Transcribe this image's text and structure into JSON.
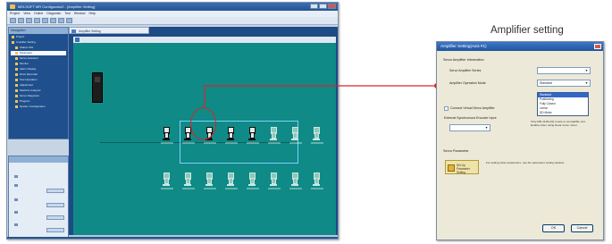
{
  "caption": "Amplifier setting",
  "software_window": {
    "title": "MELSOFT MR Configurator2 - [Amplifier Setting]",
    "menu": [
      "Project",
      "View",
      "Online",
      "Diagnosis",
      "Tool",
      "Window",
      "Help"
    ],
    "nav_pane_title": "Navigation",
    "nav_items": [
      "Project",
      "Amplifier Setting",
      "Station 001",
      "Parameter",
      "Servo Assistant",
      "Monitor",
      "Alarm Display",
      "Drive Recorder",
      "Test Operation",
      "Adjustment",
      "Machine Analyzer",
      "Servo Diagnosis",
      "Program",
      "System Configuration"
    ],
    "selected_nav_index": 3,
    "parts_pane_title": "Parts",
    "document_tab": "Amplifier Setting"
  },
  "amplifier_setting_dialog": {
    "title": "Amplifier Setting(Axis #1)",
    "section_amplifier_info": "Servo Amplifier Information",
    "label_series": "Servo Amplifier Series",
    "label_operation_mode": "Amplifier Operation Mode",
    "operation_mode_options": [
      "Standard",
      "Positioning",
      "Fully Closed",
      "Linear",
      "DD Motor"
    ],
    "operation_mode_selected_index": 0,
    "checkbox_virtual_label": "Connect Virtual Servo Amplifier",
    "label_encoder": "External Synchronous Encoder Input",
    "note_encoder": "Only MR-J4-B(-RJ) 2-axis or compatible unit. Enable when using linear servo motor.",
    "section_parameter": "Servo Parameter",
    "parameter_button_label": "Set Up Parameter Setting",
    "note_parameter": "For setting other parameters, use the parameter setting window.",
    "ok_label": "OK",
    "cancel_label": "Cancel"
  },
  "colors": {
    "callout": "#d8262c",
    "canvas_bg": "#0f8a86",
    "dialog_bg": "#ece9d8"
  }
}
